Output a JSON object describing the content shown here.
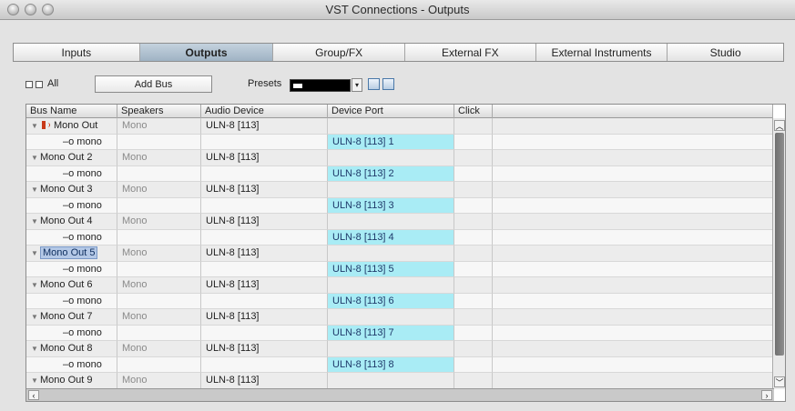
{
  "window": {
    "title": "VST Connections - Outputs"
  },
  "tabs": [
    {
      "label": "Inputs",
      "active": false
    },
    {
      "label": "Outputs",
      "active": true
    },
    {
      "label": "Group/FX",
      "active": false
    },
    {
      "label": "External FX",
      "active": false
    },
    {
      "label": "External Instruments",
      "active": false
    },
    {
      "label": "Studio",
      "active": false
    }
  ],
  "toolbar": {
    "all_label": "All",
    "add_bus_label": "Add Bus",
    "presets_label": "Presets"
  },
  "table": {
    "headers": [
      "Bus Name",
      "Speakers",
      "Audio Device",
      "Device Port",
      "Click"
    ],
    "rows": [
      {
        "bus": "Mono Out",
        "speakers": "Mono",
        "device": "ULN-8 [113]",
        "channel": "mono",
        "port": "ULN-8 [113] 1",
        "selected": false,
        "speaker_icon": true
      },
      {
        "bus": "Mono Out 2",
        "speakers": "Mono",
        "device": "ULN-8 [113]",
        "channel": "mono",
        "port": "ULN-8 [113] 2",
        "selected": false
      },
      {
        "bus": "Mono Out 3",
        "speakers": "Mono",
        "device": "ULN-8 [113]",
        "channel": "mono",
        "port": "ULN-8 [113] 3",
        "selected": false
      },
      {
        "bus": "Mono Out 4",
        "speakers": "Mono",
        "device": "ULN-8 [113]",
        "channel": "mono",
        "port": "ULN-8 [113] 4",
        "selected": false
      },
      {
        "bus": "Mono Out 5",
        "speakers": "Mono",
        "device": "ULN-8 [113]",
        "channel": "mono",
        "port": "ULN-8 [113] 5",
        "selected": true
      },
      {
        "bus": "Mono Out 6",
        "speakers": "Mono",
        "device": "ULN-8 [113]",
        "channel": "mono",
        "port": "ULN-8 [113] 6",
        "selected": false
      },
      {
        "bus": "Mono Out 7",
        "speakers": "Mono",
        "device": "ULN-8 [113]",
        "channel": "mono",
        "port": "ULN-8 [113] 7",
        "selected": false
      },
      {
        "bus": "Mono Out 8",
        "speakers": "Mono",
        "device": "ULN-8 [113]",
        "channel": "mono",
        "port": "ULN-8 [113] 8",
        "selected": false
      },
      {
        "bus": "Mono Out 9",
        "speakers": "Mono",
        "device": "ULN-8 [113]",
        "channel": "",
        "port": "",
        "selected": false
      }
    ]
  },
  "icons": {
    "expand": "expand-triangle-icon",
    "speaker": "speaker-icon",
    "channel": "channel-connector-icon"
  }
}
